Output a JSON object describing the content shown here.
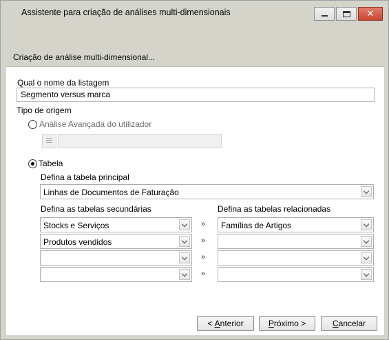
{
  "window": {
    "title": "Assistente para criação de análises multi-dimensionais",
    "banner_heading": "Criação de análise multi-dimensional..."
  },
  "form": {
    "listing_name_label": "Qual o nome da listagem",
    "listing_name_value": "Segmento versus marca",
    "source_type_label": "Tipo de origem",
    "advanced_option_label": "Análise Avançada do utilizador",
    "advanced_value": "",
    "table_option_label": "Tabela",
    "selected_source": "Tabela",
    "main_table_label": "Defina a tabela principal",
    "main_table_value": "Linhas de Documentos de Faturação",
    "secondary_tables_label": "Defina as tabelas secundárias",
    "related_tables_label": "Defina as tabelas relacionadas",
    "link_symbol": "»",
    "rows": [
      {
        "secondary": "Stocks e Serviços",
        "related": "Famílias de Artigos"
      },
      {
        "secondary": "Produtos vendidos",
        "related": ""
      },
      {
        "secondary": "",
        "related": ""
      },
      {
        "secondary": "",
        "related": ""
      }
    ]
  },
  "buttons": {
    "back_prefix": "< ",
    "back_key": "A",
    "back_rest": "nterior",
    "next_key": "P",
    "next_rest": "róximo >",
    "cancel_key": "C",
    "cancel_rest": "ancelar"
  },
  "icons": {
    "minimize": "minimize-icon",
    "maximize": "maximize-icon",
    "close": "close-icon",
    "dropdown": "chevron-down-icon",
    "picker": "list-icon"
  }
}
